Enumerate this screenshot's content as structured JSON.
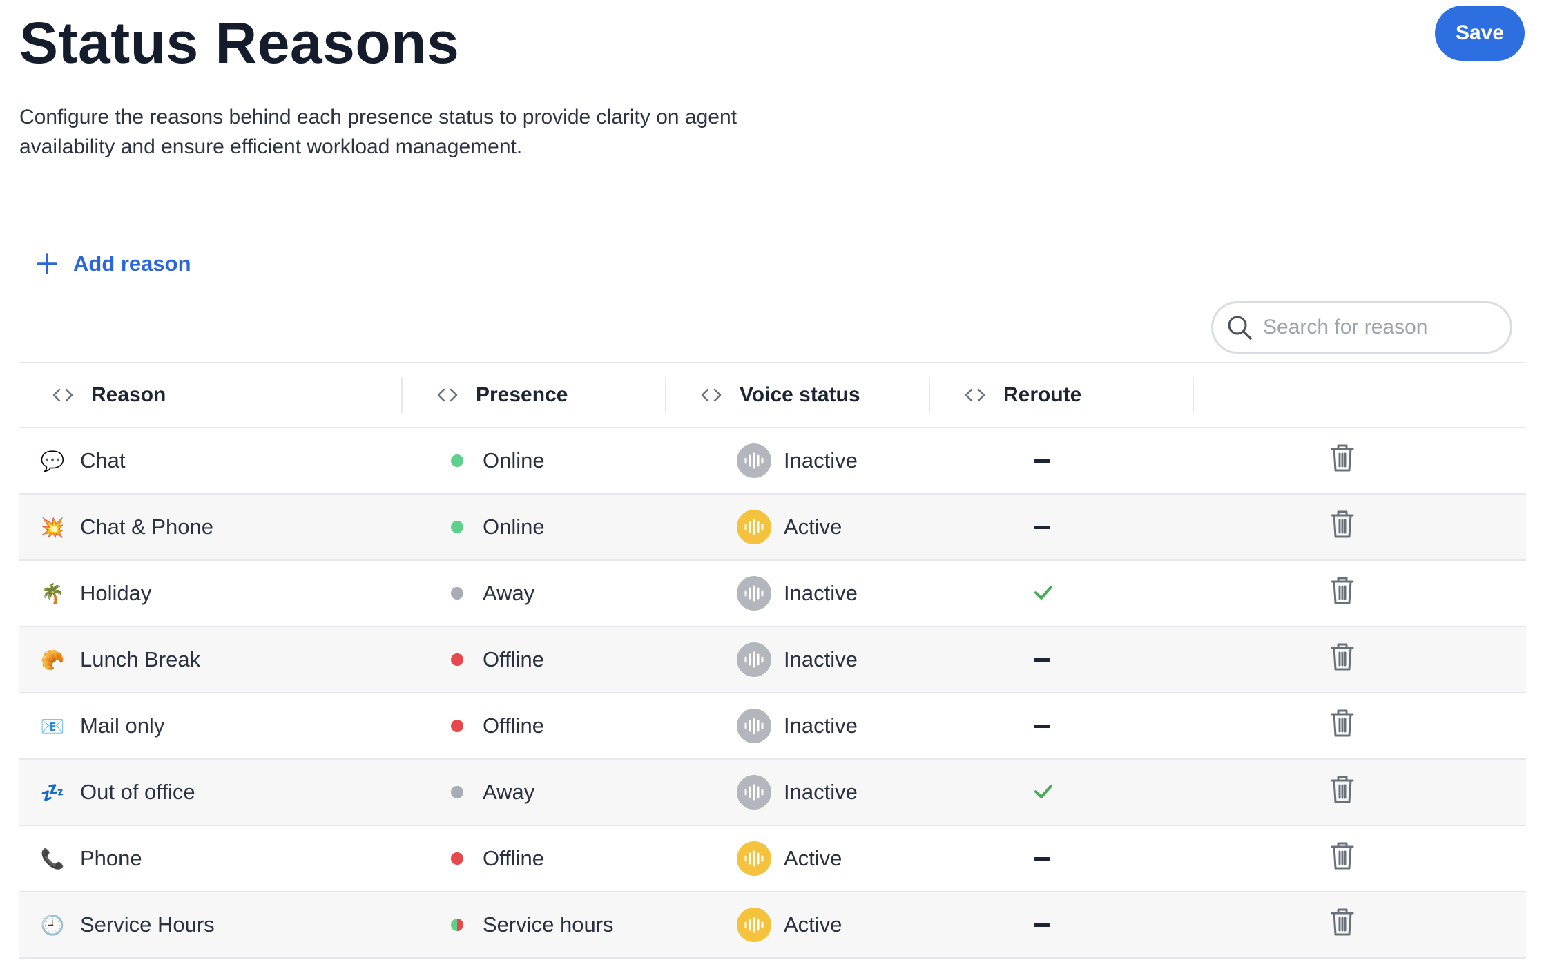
{
  "page": {
    "title": "Status Reasons",
    "description": "Configure the reasons behind each presence status to provide clarity on agent availability and ensure efficient workload management.",
    "save_label": "Save",
    "add_reason_label": "Add reason",
    "search_placeholder": "Search for reason"
  },
  "columns": {
    "reason": "Reason",
    "presence": "Presence",
    "voice_status": "Voice status",
    "reroute": "Reroute"
  },
  "colors": {
    "accent": "#2d6fe0",
    "online": "#5fd08c",
    "away": "#a8adb5",
    "offline": "#e5484d",
    "voice_active": "#f4c23c",
    "voice_inactive": "#b3b7bd",
    "check": "#4bab56"
  },
  "rows": [
    {
      "emoji": "💬",
      "reason": "Chat",
      "presence": "Online",
      "presence_kind": "online",
      "voice": "Inactive",
      "reroute": false
    },
    {
      "emoji": "💥",
      "reason": "Chat & Phone",
      "presence": "Online",
      "presence_kind": "online",
      "voice": "Active",
      "reroute": false
    },
    {
      "emoji": "🌴",
      "reason": "Holiday",
      "presence": "Away",
      "presence_kind": "away",
      "voice": "Inactive",
      "reroute": true
    },
    {
      "emoji": "🥐",
      "reason": "Lunch Break",
      "presence": "Offline",
      "presence_kind": "offline",
      "voice": "Inactive",
      "reroute": false
    },
    {
      "emoji": "📧",
      "reason": "Mail only",
      "presence": "Offline",
      "presence_kind": "offline",
      "voice": "Inactive",
      "reroute": false
    },
    {
      "emoji": "💤",
      "reason": "Out of office",
      "presence": "Away",
      "presence_kind": "away",
      "voice": "Inactive",
      "reroute": true
    },
    {
      "emoji": "📞",
      "reason": "Phone",
      "presence": "Offline",
      "presence_kind": "offline",
      "voice": "Active",
      "reroute": false
    },
    {
      "emoji": "🕘",
      "reason": "Service Hours",
      "presence": "Service hours",
      "presence_kind": "service",
      "voice": "Active",
      "reroute": false
    }
  ]
}
